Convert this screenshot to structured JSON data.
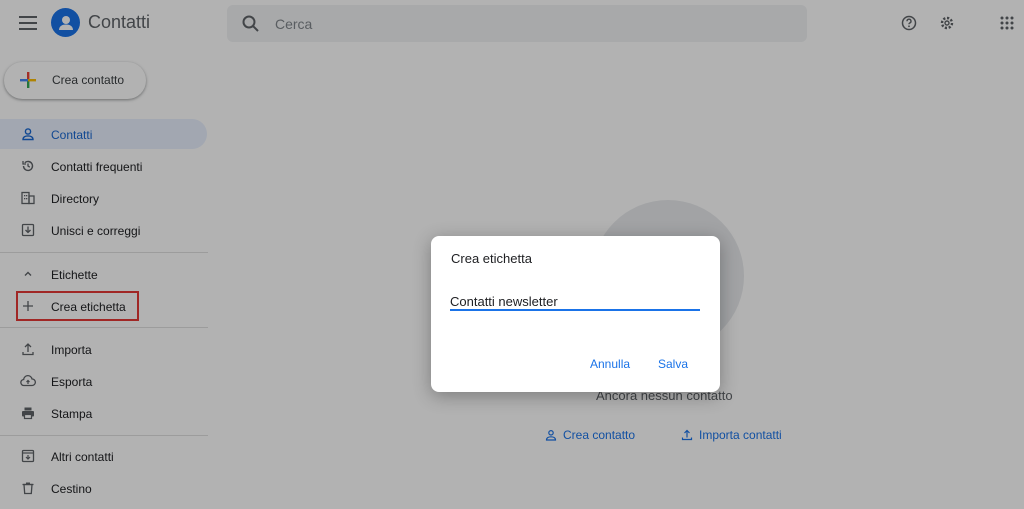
{
  "header": {
    "app_title": "Contatti",
    "search_placeholder": "Cerca"
  },
  "sidebar": {
    "create_contact_label": "Crea contatto",
    "items": [
      {
        "label": "Contatti",
        "icon": "person-icon",
        "active": true
      },
      {
        "label": "Contatti frequenti",
        "icon": "history-icon"
      },
      {
        "label": "Directory",
        "icon": "building-icon"
      },
      {
        "label": "Unisci e correggi",
        "icon": "merge-icon"
      }
    ],
    "labels_section": {
      "label": "Etichette",
      "icon": "chevron-up-icon"
    },
    "create_label": {
      "label": "Crea etichetta",
      "icon": "plus-icon"
    },
    "tools": [
      {
        "label": "Importa",
        "icon": "upload-icon"
      },
      {
        "label": "Esporta",
        "icon": "cloud-upload-icon"
      },
      {
        "label": "Stampa",
        "icon": "print-icon"
      }
    ],
    "other": [
      {
        "label": "Altri contatti",
        "icon": "archive-icon"
      },
      {
        "label": "Cestino",
        "icon": "trash-icon"
      }
    ]
  },
  "main": {
    "empty_message": "Ancora nessun contatto",
    "create_contact_action": "Crea contatto",
    "import_contacts_action": "Importa contatti"
  },
  "dialog": {
    "title": "Crea etichetta",
    "input_value": "Contatti newsletter",
    "cancel_label": "Annulla",
    "save_label": "Salva"
  },
  "colors": {
    "accent": "#1a73e8",
    "active_bg": "#e8f0fe",
    "highlight": "#e53935"
  }
}
